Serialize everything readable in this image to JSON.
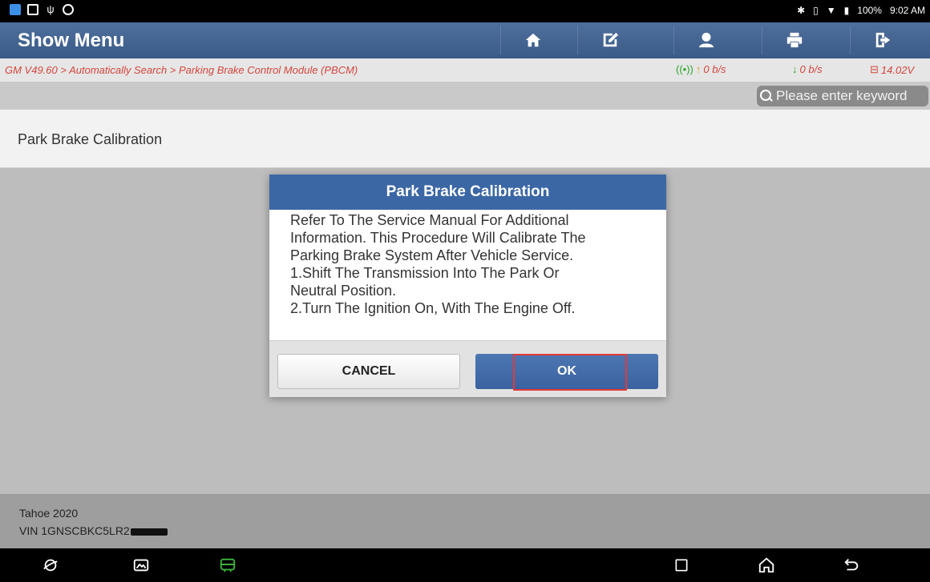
{
  "status_bar": {
    "battery": "100%",
    "time": "9:02 AM",
    "icons": [
      "bluetooth-icon",
      "vibrate-icon",
      "wifi-icon",
      "battery-icon"
    ]
  },
  "header": {
    "title": "Show Menu",
    "buttons": [
      "home-icon",
      "edit-report-icon",
      "user-profile-icon",
      "print-icon",
      "exit-icon"
    ]
  },
  "breadcrumb": "GM V49.60 > Automatically Search > Parking Brake Control Module (PBCM)",
  "network": {
    "upload": "0 b/s",
    "download": "0 b/s",
    "voltage": "14.02V"
  },
  "search": {
    "placeholder": "Please enter keyword"
  },
  "menu_items": [
    "Park Brake Calibration"
  ],
  "vehicle": {
    "model": "Tahoe 2020",
    "vin": "VIN 1GNSCBKC5LR2"
  },
  "dialog": {
    "title": "Park Brake Calibration",
    "message": "Refer To The Service Manual For Additional\nInformation. This Procedure Will Calibrate The\nParking Brake System After Vehicle Service.\n1.Shift The Transmission Into The Park Or\nNeutral Position.\n2.Turn The Ignition On, With The Engine Off.",
    "cancel_label": "CANCEL",
    "ok_label": "OK"
  },
  "colors": {
    "header_blue": "#3a5a88",
    "dialog_header": "#3b67a5",
    "breadcrumb_red": "#d2463c",
    "highlight_red": "#e53935"
  }
}
